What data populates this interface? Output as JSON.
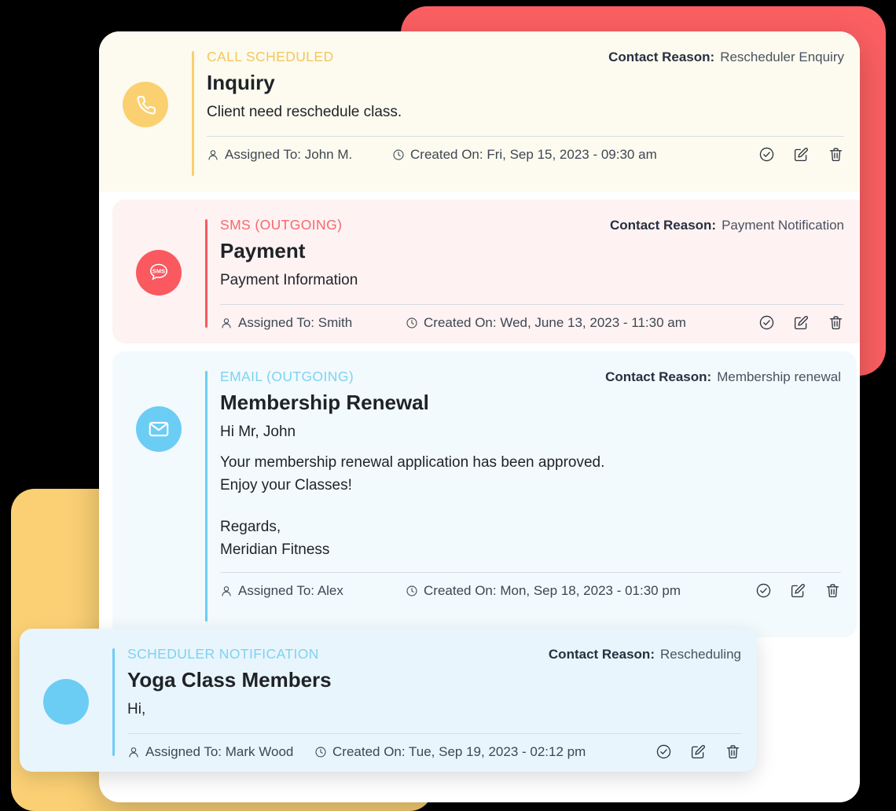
{
  "theme": {
    "red_plate": "#FB5F62",
    "yellow_plate": "#FBD074",
    "panel": "#FFFFFF",
    "call_accent": "#F9CF6E",
    "sms_accent": "#F9595F",
    "email_accent": "#6CCDF4",
    "bell_accent": "#6CCDF4"
  },
  "labels": {
    "contact_reason": "Contact Reason:",
    "assigned_prefix": "Assigned To:",
    "created_prefix": "Created On:"
  },
  "actions": {
    "complete": "Mark complete",
    "edit": "Edit",
    "delete": "Delete"
  },
  "cards": [
    {
      "kicker": "CALL SCHEDULED",
      "title": "Inquiry",
      "body_lines": [
        "Client need reschedule class."
      ],
      "contact_reason": "Rescheduler Enquiry",
      "assigned_to": "Assigned To: John M.",
      "created_on": "Created On: Fri, Sep 15, 2023 - 09:30 am",
      "icon": "phone-icon",
      "accent_color": "#F9CF6E",
      "background": "#FDFBEF"
    },
    {
      "kicker": "SMS (OUTGOING)",
      "title": "Payment",
      "body_lines": [
        "Payment Information"
      ],
      "contact_reason": "Payment Notification",
      "assigned_to": "Assigned To: Smith",
      "created_on": "Created On: Wed, June 13, 2023 - 11:30 am",
      "icon": "sms-bubble-icon",
      "accent_color": "#F9595F",
      "background": "#FEF2F2"
    },
    {
      "kicker": "EMAIL (OUTGOING)",
      "title": "Membership Renewal",
      "body_lines": [
        "Hi Mr, John",
        "Your membership renewal application has been approved.",
        "Enjoy your Classes!",
        "Regards,",
        "Meridian Fitness"
      ],
      "contact_reason": "Membership renewal",
      "assigned_to": "Assigned To: Alex",
      "created_on": "Created On: Mon, Sep 18, 2023 - 01:30 pm",
      "icon": "envelope-icon",
      "accent_color": "#6CCDF4",
      "background": "#F2FAFD"
    },
    {
      "kicker": "SCHEDULER NOTIFICATION",
      "title": "Yoga Class Members",
      "body_lines": [
        "Hi,"
      ],
      "contact_reason": "Rescheduling",
      "assigned_to": "Assigned To: Mark Wood",
      "created_on": "Created On: Tue, Sep 19, 2023 - 02:12 pm",
      "icon": "circle-avatar-icon",
      "accent_color": "#6CCDF4",
      "background": "#E9F5FC"
    }
  ]
}
